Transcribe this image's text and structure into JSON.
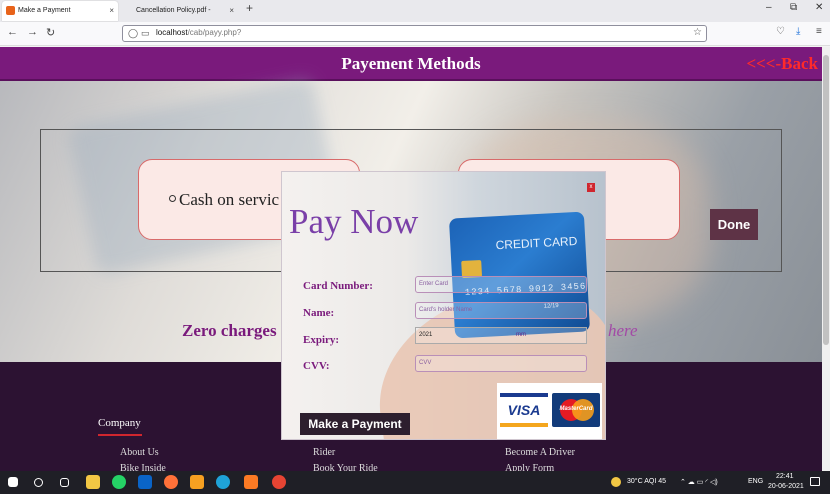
{
  "browser": {
    "tabs": [
      {
        "label": "Make a Payment",
        "close": "×"
      },
      {
        "label": "Cancellation Policy.pdf - Cancellati",
        "close": "×"
      }
    ],
    "new_tab": "+",
    "window_controls": [
      "–",
      "⧉",
      "✕"
    ],
    "nav": {
      "back": "←",
      "forward": "→",
      "reload": "↻"
    },
    "url_host": "localhost",
    "url_path": "/cab/payy.php?",
    "right_icons": [
      "♡",
      "⤓",
      "≡"
    ]
  },
  "header": {
    "title": "Payement Methods",
    "back_link": "<<<-Back"
  },
  "payment_options": {
    "cash_label": "Cash on servic",
    "done_label": "Done"
  },
  "promo": {
    "text": "Zero charges",
    "here": "here"
  },
  "footer": {
    "company_heading": "Company",
    "links": [
      {
        "label": "About Us"
      },
      {
        "label": "Rider"
      },
      {
        "label": "Become A Driver"
      },
      {
        "label": "Bike Inside"
      },
      {
        "label": "Book Your Ride"
      },
      {
        "label": "Apply Form"
      }
    ]
  },
  "modal": {
    "close_label": "x",
    "title": "Pay Now",
    "card_text": {
      "brand": "CREDIT CARD",
      "number": "1234 5678 9012 3456",
      "date": "12/19"
    },
    "fields": {
      "card_number_label": "Card Number:",
      "card_number_placeholder": "Enter Card",
      "name_label": "Name:",
      "name_placeholder": "Card's holder Name",
      "expiry_label": "Expiry:",
      "expiry_value": "2021",
      "expiry_month": "mm",
      "cvv_label": "CVV:",
      "cvv_placeholder": "CVV"
    },
    "submit_label": "Make a Payment",
    "card_logos": {
      "visa": "VISA",
      "mastercard": "MasterCard"
    }
  },
  "taskbar": {
    "weather": "30°C  AQI 45",
    "lang": "ENG",
    "time": "22:41",
    "date": "20-06-2021"
  },
  "colors": {
    "header": "#7a1a7c",
    "back_link": "#ff2a2a",
    "footer": "#2c1232",
    "done_button": "#5e3346"
  }
}
